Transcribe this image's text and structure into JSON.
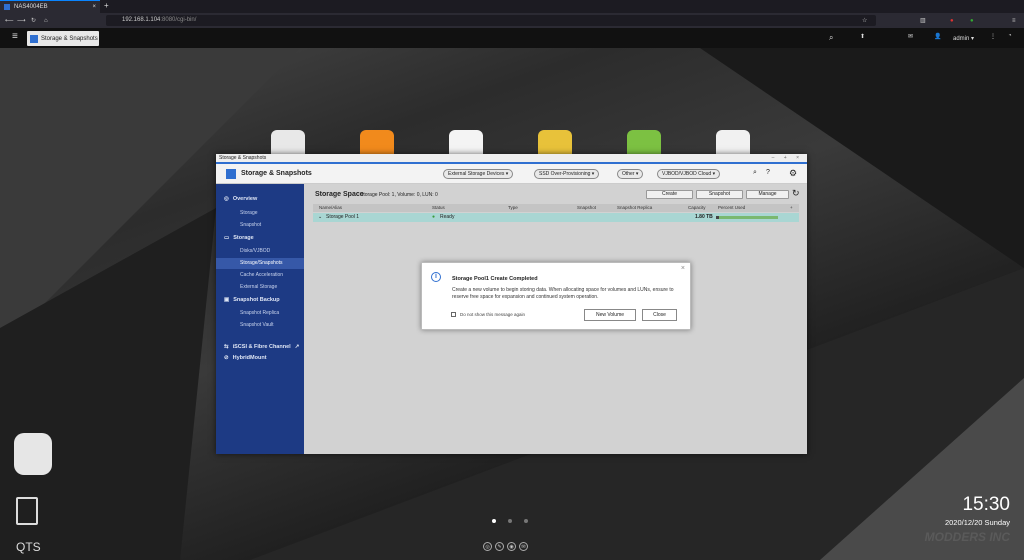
{
  "browser": {
    "tab_title": "NAS4004EB",
    "url_host": "192.168.1.104",
    "url_rest": ":8080/cgi-bin/"
  },
  "qts": {
    "taskbar_tab": "Storage & Snapshots",
    "user": "admin ▾"
  },
  "window": {
    "small_title": "Storage & Snapshots",
    "title": "Storage & Snapshots",
    "toolbar": [
      "External Storage Devices ▾",
      "SSD Over-Provisioning ▾",
      "Other ▾",
      "VJBOD/VJBOD Cloud ▾"
    ],
    "sidebar": {
      "overview": "Overview",
      "storage_link": "Storage",
      "snapshot_link": "Snapshot",
      "storage": "Storage",
      "disks": "Disks/VJBOD",
      "storage_snapshots": "Storage/Snapshots",
      "cache": "Cache Acceleration",
      "external": "External Storage",
      "backup": "Snapshot Backup",
      "replica": "Snapshot Replica",
      "vault": "Snapshot Vault",
      "iscsi": "iSCSI & Fibre Channel",
      "hybrid": "HybridMount"
    },
    "main": {
      "heading": "Storage Space",
      "summary": "Storage Pool: 1, Volume: 0, LUN: 0",
      "create_btn": "Create",
      "snapshot_btn": "Snapshot",
      "manage_btn": "Manage",
      "columns": [
        "Name/Alias",
        "Status",
        "Type",
        "Snapshot",
        "Snapshot Replica",
        "Capacity",
        "Percent Used",
        "+"
      ],
      "row": {
        "name": "Storage Pool 1",
        "status": "Ready",
        "capacity": "1.80 TB",
        "percent_used": 0.05
      }
    }
  },
  "dialog": {
    "title": "Storage Pool1 Create Completed",
    "message": "Create a new volume to begin storing data. When allocating space for volumes and LUNs, ensure to reserve free space for expansion and continued system operation.",
    "checkbox": "Do not show this message again",
    "new_volume": "New Volume",
    "close": "Close"
  },
  "desktop": {
    "time": "15:30",
    "date": "2020/12/20 Sunday",
    "brand": "QTS",
    "watermark": "MODDERS INC"
  },
  "colors": {
    "accent": "#2f6fd0",
    "sidebar": "#1d3a84",
    "row_highlight": "#a9d6d3"
  }
}
